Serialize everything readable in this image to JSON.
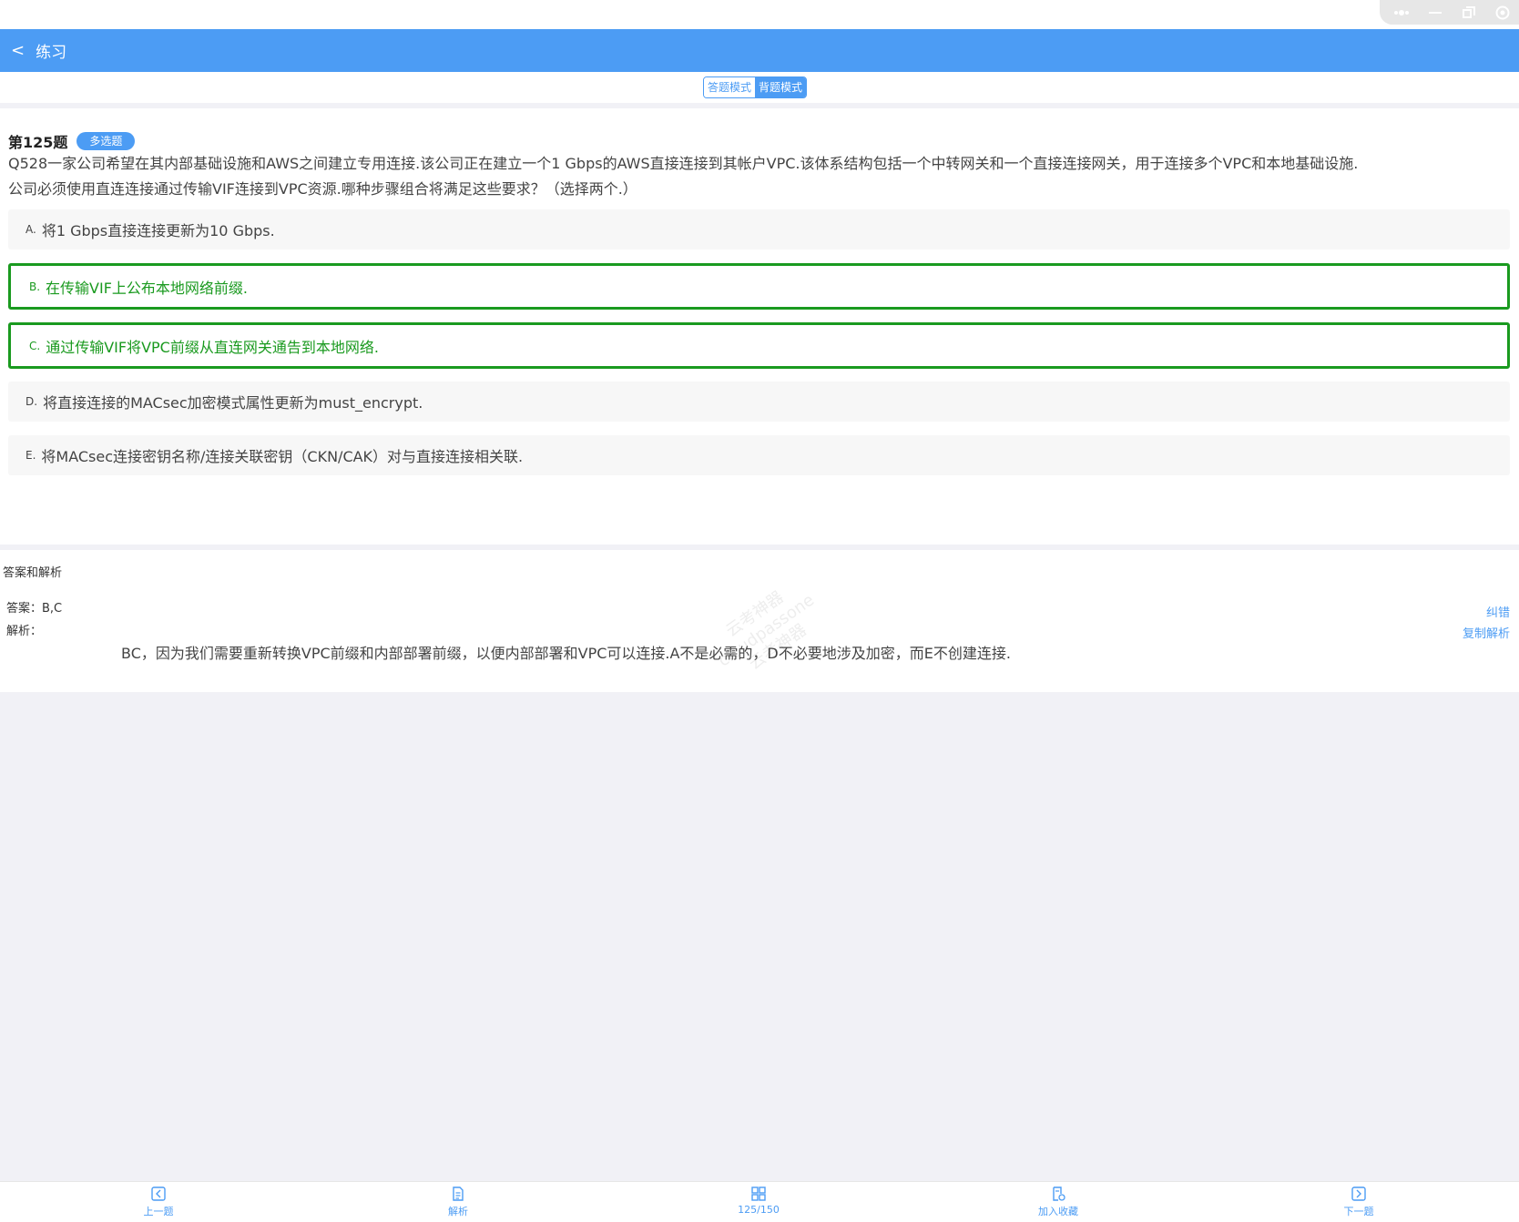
{
  "header": {
    "back_label": "<",
    "title": "练习"
  },
  "mode_toggle": {
    "answer_mode": "答题模式",
    "memorize_mode": "背题模式",
    "active": "memorize_mode"
  },
  "question": {
    "number": "第125题",
    "type_badge": "多选题",
    "line1": "Q528一家公司希望在其内部基础设施和AWS之间建立专用连接.该公司正在建立一个1 Gbps的AWS直接连接到其帐户VPC.该体系结构包括一个中转网关和一个直接连接网关，用于连接多个VPC和本地基础设施.",
    "line2": "公司必须使用直连连接通过传输VIF连接到VPC资源.哪种步骤组合将满足这些要求？（选择两个.）"
  },
  "options": [
    {
      "letter": "A.",
      "text": "将1 Gbps直接连接更新为10 Gbps.",
      "correct": false
    },
    {
      "letter": "B.",
      "text": "在传输VIF上公布本地网络前缀.",
      "correct": true
    },
    {
      "letter": "C.",
      "text": "通过传输VIF将VPC前缀从直连网关通告到本地网络.",
      "correct": true
    },
    {
      "letter": "D.",
      "text": "将直接连接的MACsec加密模式属性更新为must_encrypt.",
      "correct": false
    },
    {
      "letter": "E.",
      "text": "将MACsec连接密钥名称/连接关联密钥（CKN/CAK）对与直接连接相关联.",
      "correct": false
    }
  ],
  "answer_section": {
    "heading": "答案和解析",
    "answer_line": "答案：B,C",
    "explanation_label": "解析：",
    "explanation": "BC，因为我们需要重新转换VPC前缀和内部部署前缀，以便内部部署和VPC可以连接.A不是必需的，D不必要地涉及加密，而E不创建连接.",
    "report_link": "纠错",
    "copy_link": "复制解析"
  },
  "watermark": {
    "line1": "云考神器",
    "line2": "cloudpassone",
    "line3": "云考神器"
  },
  "bottom_nav": {
    "prev": "上一题",
    "analysis": "解析",
    "progress": "125/150",
    "favorite": "加入收藏",
    "next": "下一题"
  },
  "colors": {
    "brand": "#4c9cf4",
    "correct": "#1a9a1f",
    "background": "#f1f1f6"
  }
}
